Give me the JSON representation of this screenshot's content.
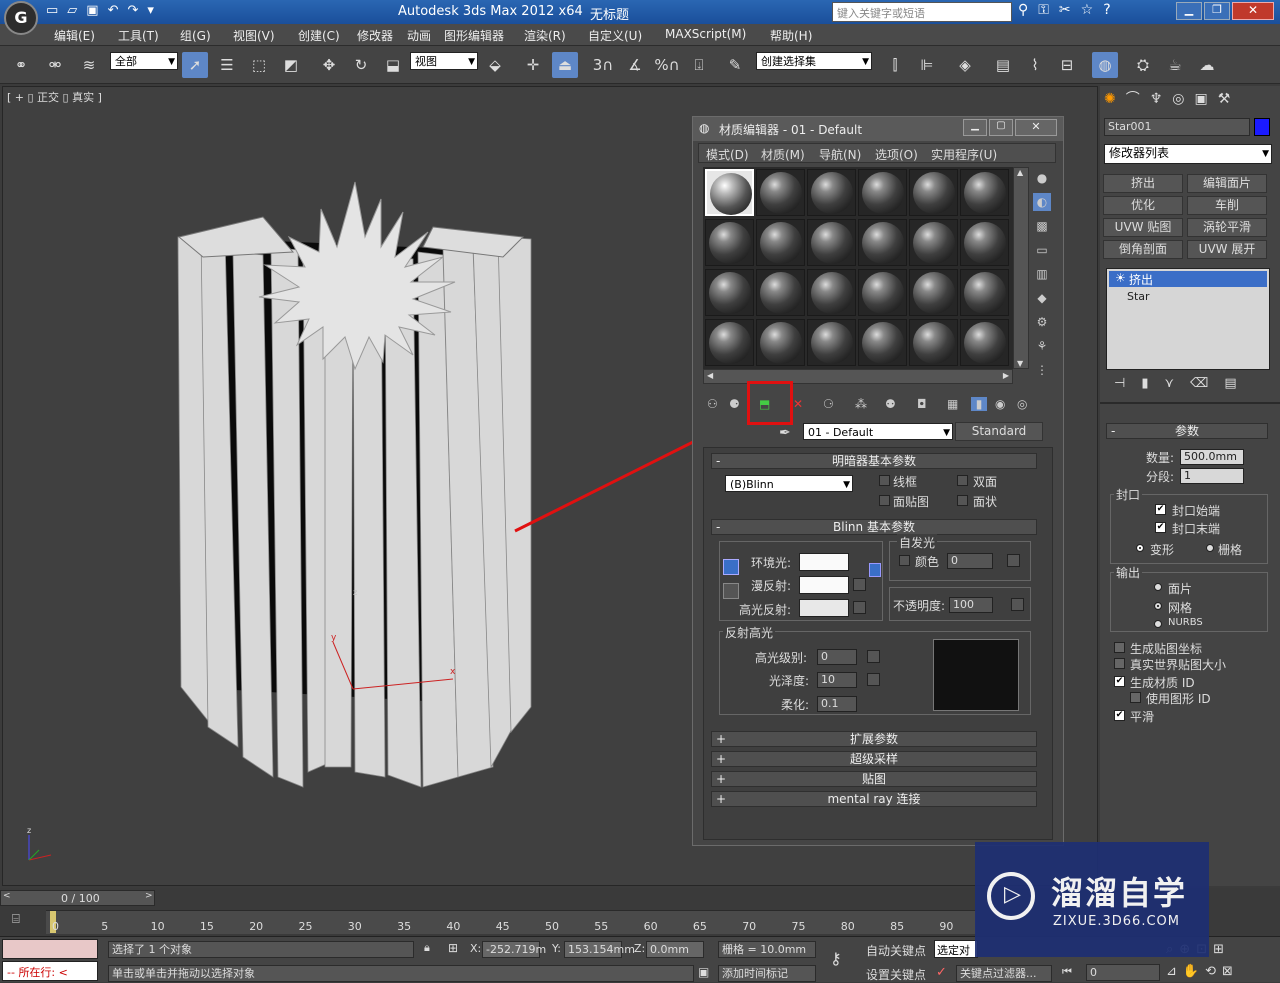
{
  "app": {
    "title": "Autodesk 3ds Max  2012 x64",
    "doc": "无标题",
    "search_placeholder": "键入关键字或短语"
  },
  "menu": [
    "编辑(E)",
    "工具(T)",
    "组(G)",
    "视图(V)",
    "创建(C)",
    "修改器",
    "动画",
    "图形编辑器",
    "渲染(R)",
    "自定义(U)",
    "MAXScript(M)",
    "帮助(H)"
  ],
  "toolbar": {
    "filter": "全部",
    "refcoord": "视图",
    "selset": "创建选择集",
    "snap3": "3",
    "anglepct": "%"
  },
  "viewport": {
    "label": "[ + ▯ 正交 ▯ 真实 ]",
    "axis_x": "x",
    "axis_y": "y",
    "axis_z": "z"
  },
  "mated": {
    "title": "材质编辑器 - 01 - Default",
    "menu": [
      "模式(D)",
      "材质(M)",
      "导航(N)",
      "选项(O)",
      "实用程序(U)"
    ],
    "matname": "01 - Default",
    "mattype": "Standard",
    "shader_rollout": "明暗器基本参数",
    "shader": "(B)Blinn",
    "wire": "线框",
    "twosided": "双面",
    "facemap": "面贴图",
    "faceted": "面状",
    "blinn_rollout": "Blinn 基本参数",
    "selfillum": "自发光",
    "color": "颜色",
    "selfillum_val": "0",
    "ambient": "环境光:",
    "diffuse": "漫反射:",
    "specular": "高光反射:",
    "opacity": "不透明度:",
    "opacity_val": "100",
    "spec_hl": "反射高光",
    "spec_level": "高光级别:",
    "spec_level_val": "0",
    "gloss": "光泽度:",
    "gloss_val": "10",
    "soften": "柔化:",
    "soften_val": "0.1",
    "rollouts": [
      "扩展参数",
      "超级采样",
      "贴图",
      "mental ray 连接"
    ]
  },
  "cmd": {
    "objname": "Star001",
    "objcolor": "#1a1aff",
    "modlist": "修改器列表",
    "btns": [
      "挤出",
      "编辑面片",
      "优化",
      "车削",
      "UVW 贴图",
      "涡轮平滑",
      "倒角剖面",
      "UVW 展开"
    ],
    "stack": [
      "挤出",
      "Star"
    ],
    "params": "参数",
    "amount": "数量:",
    "amount_val": "500.0mm",
    "segs": "分段:",
    "segs_val": "1",
    "capping": "封口",
    "capstart": "封口始端",
    "capend": "封口末端",
    "morph": "变形",
    "grid": "栅格",
    "output": "输出",
    "patch": "面片",
    "mesh": "网格",
    "nurbs": "NURBS",
    "genmap": "生成贴图坐标",
    "realworld": "真实世界贴图大小",
    "genmatid": "生成材质 ID",
    "useshapeid": "使用图形 ID",
    "smooth": "平滑"
  },
  "timeline": {
    "frame": "0 / 100",
    "ticks": [
      "0",
      "5",
      "10",
      "15",
      "20",
      "25",
      "30",
      "35",
      "40",
      "45",
      "50",
      "55",
      "60",
      "65",
      "70",
      "75",
      "80",
      "85",
      "90"
    ]
  },
  "status": {
    "selected": "选择了 1 个对象",
    "hint": "单击或单击并拖动以选择对象",
    "x": "-252.719m",
    "y": "153.154mm",
    "z": "0.0mm",
    "xl": "X:",
    "yl": "Y:",
    "zl": "Z:",
    "grid": "栅格 = 10.0mm",
    "autokey": "自动关键点",
    "setkey": "设置关键点",
    "selsel": "选定对",
    "keyfilter": "关键点过滤器...",
    "addtime": "添加时间标记",
    "running": "所在行:",
    "frame_val": "0"
  },
  "watermark": {
    "cn": "溜溜自学",
    "url": "ZIXUE.3D66.COM"
  }
}
